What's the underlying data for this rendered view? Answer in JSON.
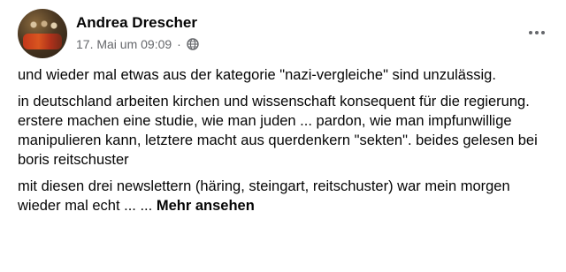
{
  "post": {
    "author": "Andrea Drescher",
    "timestamp": "17. Mai um 09:09",
    "separator": "·",
    "privacy_icon": "globe-icon",
    "menu_icon": "more-options-icon",
    "paragraphs": [
      "und wieder mal etwas aus der kategorie \"nazi-vergleiche\" sind unzulässig.",
      "in deutschland arbeiten kirchen und wissenschaft konsequent für die regierung. erstere machen eine studie, wie man juden ... pardon, wie man impfunwillige manipulieren kann, letztere macht aus querdenkern \"sekten\". beides gelesen bei boris reitschuster",
      "mit diesen drei newslettern (häring, steingart, reitschuster) war mein morgen wieder mal echt ... ..."
    ],
    "see_more": "Mehr ansehen"
  }
}
